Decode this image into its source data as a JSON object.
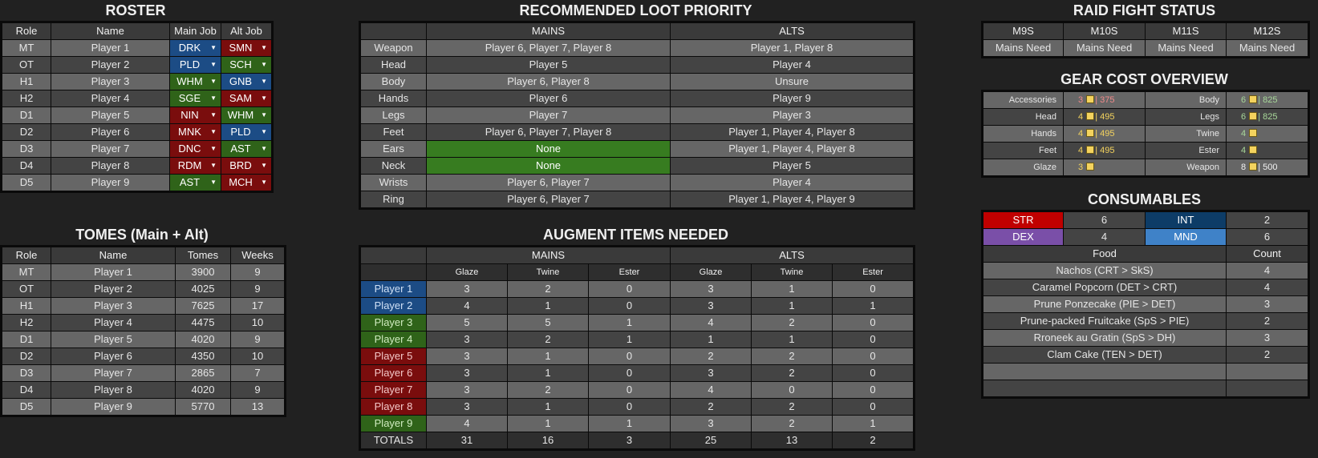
{
  "roster": {
    "title": "ROSTER",
    "headers": [
      "Role",
      "Name",
      "Main Job",
      "Alt Job"
    ],
    "rows": [
      {
        "role": "MT",
        "name": "Player 1",
        "main": "DRK",
        "main_color": "#1c4c85",
        "alt": "SMN",
        "alt_color": "#7a0d0d"
      },
      {
        "role": "OT",
        "name": "Player 2",
        "main": "PLD",
        "main_color": "#1c4c85",
        "alt": "SCH",
        "alt_color": "#2f6319"
      },
      {
        "role": "H1",
        "name": "Player 3",
        "main": "WHM",
        "main_color": "#2f6319",
        "alt": "GNB",
        "alt_color": "#1c4c85"
      },
      {
        "role": "H2",
        "name": "Player 4",
        "main": "SGE",
        "main_color": "#2f6319",
        "alt": "SAM",
        "alt_color": "#7a0d0d"
      },
      {
        "role": "D1",
        "name": "Player 5",
        "main": "NIN",
        "main_color": "#7a0d0d",
        "alt": "WHM",
        "alt_color": "#2f6319"
      },
      {
        "role": "D2",
        "name": "Player 6",
        "main": "MNK",
        "main_color": "#7a0d0d",
        "alt": "PLD",
        "alt_color": "#1c4c85"
      },
      {
        "role": "D3",
        "name": "Player 7",
        "main": "DNC",
        "main_color": "#7a0d0d",
        "alt": "AST",
        "alt_color": "#2f6319"
      },
      {
        "role": "D4",
        "name": "Player 8",
        "main": "RDM",
        "main_color": "#7a0d0d",
        "alt": "BRD",
        "alt_color": "#7a0d0d"
      },
      {
        "role": "D5",
        "name": "Player 9",
        "main": "AST",
        "main_color": "#2f6319",
        "alt": "MCH",
        "alt_color": "#7a0d0d"
      }
    ]
  },
  "tomes": {
    "title": "TOMES (Main + Alt)",
    "headers": [
      "Role",
      "Name",
      "Tomes",
      "Weeks"
    ],
    "rows": [
      {
        "role": "MT",
        "name": "Player 1",
        "tomes": "3900",
        "weeks": "9"
      },
      {
        "role": "OT",
        "name": "Player 2",
        "tomes": "4025",
        "weeks": "9"
      },
      {
        "role": "H1",
        "name": "Player 3",
        "tomes": "7625",
        "weeks": "17"
      },
      {
        "role": "H2",
        "name": "Player 4",
        "tomes": "4475",
        "weeks": "10"
      },
      {
        "role": "D1",
        "name": "Player 5",
        "tomes": "4020",
        "weeks": "9"
      },
      {
        "role": "D2",
        "name": "Player 6",
        "tomes": "4350",
        "weeks": "10"
      },
      {
        "role": "D3",
        "name": "Player 7",
        "tomes": "2865",
        "weeks": "7"
      },
      {
        "role": "D4",
        "name": "Player 8",
        "tomes": "4020",
        "weeks": "9"
      },
      {
        "role": "D5",
        "name": "Player 9",
        "tomes": "5770",
        "weeks": "13"
      }
    ]
  },
  "loot": {
    "title": "RECOMMENDED LOOT PRIORITY",
    "headers": [
      "",
      "MAINS",
      "ALTS"
    ],
    "rows": [
      {
        "slot": "Weapon",
        "mains": "Player 6, Player 7, Player 8",
        "alts": "Player 1, Player 8"
      },
      {
        "slot": "Head",
        "mains": "Player 5",
        "alts": "Player 4"
      },
      {
        "slot": "Body",
        "mains": "Player 6, Player 8",
        "alts": "Unsure"
      },
      {
        "slot": "Hands",
        "mains": "Player 6",
        "alts": "Player 9"
      },
      {
        "slot": "Legs",
        "mains": "Player 7",
        "alts": "Player 3"
      },
      {
        "slot": "Feet",
        "mains": "Player 6, Player 7, Player 8",
        "alts": "Player 1, Player 4, Player 8"
      },
      {
        "slot": "Ears",
        "mains": "None",
        "alts": "Player 1, Player 4, Player 8",
        "mains_highlight": true
      },
      {
        "slot": "Neck",
        "mains": "None",
        "alts": "Player 5",
        "mains_highlight": true
      },
      {
        "slot": "Wrists",
        "mains": "Player 6, Player 7",
        "alts": "Player 4"
      },
      {
        "slot": "Ring",
        "mains": "Player 6, Player 7",
        "alts": "Player 1, Player 4, Player 9"
      }
    ]
  },
  "augment": {
    "title": "AUGMENT ITEMS NEEDED",
    "group_headers": [
      "MAINS",
      "ALTS"
    ],
    "sub_headers": [
      "Glaze",
      "Twine",
      "Ester",
      "Glaze",
      "Twine",
      "Ester"
    ],
    "rows": [
      {
        "player": "Player 1",
        "color": "blue",
        "vals": [
          "3",
          "2",
          "0",
          "3",
          "1",
          "0"
        ]
      },
      {
        "player": "Player 2",
        "color": "blue",
        "vals": [
          "4",
          "1",
          "0",
          "3",
          "1",
          "1"
        ]
      },
      {
        "player": "Player 3",
        "color": "green",
        "vals": [
          "5",
          "5",
          "1",
          "4",
          "2",
          "0"
        ]
      },
      {
        "player": "Player 4",
        "color": "green",
        "vals": [
          "3",
          "2",
          "1",
          "1",
          "1",
          "0"
        ]
      },
      {
        "player": "Player 5",
        "color": "red",
        "vals": [
          "3",
          "1",
          "0",
          "2",
          "2",
          "0"
        ]
      },
      {
        "player": "Player 6",
        "color": "red",
        "vals": [
          "3",
          "1",
          "0",
          "3",
          "2",
          "0"
        ]
      },
      {
        "player": "Player 7",
        "color": "red",
        "vals": [
          "3",
          "2",
          "0",
          "4",
          "0",
          "0"
        ]
      },
      {
        "player": "Player 8",
        "color": "red",
        "vals": [
          "3",
          "1",
          "0",
          "2",
          "2",
          "0"
        ]
      },
      {
        "player": "Player 9",
        "color": "green",
        "vals": [
          "4",
          "1",
          "1",
          "3",
          "2",
          "1"
        ]
      }
    ],
    "totals_label": "TOTALS",
    "totals": [
      "31",
      "16",
      "3",
      "25",
      "13",
      "2"
    ]
  },
  "raid_status": {
    "title": "RAID FIGHT STATUS",
    "fights": [
      "M9S",
      "M10S",
      "M11S",
      "M12S"
    ],
    "status": [
      "Mains Need",
      "Mains Need",
      "Mains Need",
      "Mains Need"
    ]
  },
  "gear_cost": {
    "title": "GEAR COST OVERVIEW",
    "rows": [
      {
        "l_label": "Accessories",
        "l_count": "3",
        "l_cost": "375",
        "l_color": "red",
        "r_label": "Body",
        "r_count": "6",
        "r_cost": "825",
        "r_color": "green"
      },
      {
        "l_label": "Head",
        "l_count": "4",
        "l_cost": "495",
        "l_color": "yellow",
        "r_label": "Legs",
        "r_count": "6",
        "r_cost": "825",
        "r_color": "green"
      },
      {
        "l_label": "Hands",
        "l_count": "4",
        "l_cost": "495",
        "l_color": "yellow",
        "r_label": "Twine",
        "r_count": "4",
        "r_cost": "",
        "r_color": "green"
      },
      {
        "l_label": "Feet",
        "l_count": "4",
        "l_cost": "495",
        "l_color": "yellow",
        "r_label": "Ester",
        "r_count": "4",
        "r_cost": "",
        "r_color": "green"
      },
      {
        "l_label": "Glaze",
        "l_count": "3",
        "l_cost": "",
        "l_color": "yellow",
        "r_label": "Weapon",
        "r_count": "8",
        "r_cost": "500",
        "r_color": "white"
      }
    ]
  },
  "consumables": {
    "title": "CONSUMABLES",
    "stats": [
      {
        "label": "STR",
        "value": "6",
        "color": "#c00000"
      },
      {
        "label": "INT",
        "value": "2",
        "color": "#0d3c67"
      },
      {
        "label": "DEX",
        "value": "4",
        "color": "#7a4fa8"
      },
      {
        "label": "MND",
        "value": "6",
        "color": "#3f82c8"
      }
    ],
    "food_headers": [
      "Food",
      "Count"
    ],
    "food": [
      {
        "name": "Nachos (CRT > SkS)",
        "count": "4"
      },
      {
        "name": "Caramel Popcorn (DET > CRT)",
        "count": "4"
      },
      {
        "name": "Prune Ponzecake (PIE > DET)",
        "count": "3"
      },
      {
        "name": "Prune-packed Fruitcake (SpS > PIE)",
        "count": "2"
      },
      {
        "name": "Rroneek au Gratin (SpS > DH)",
        "count": "3"
      },
      {
        "name": "Clam Cake (TEN > DET)",
        "count": "2"
      }
    ]
  }
}
